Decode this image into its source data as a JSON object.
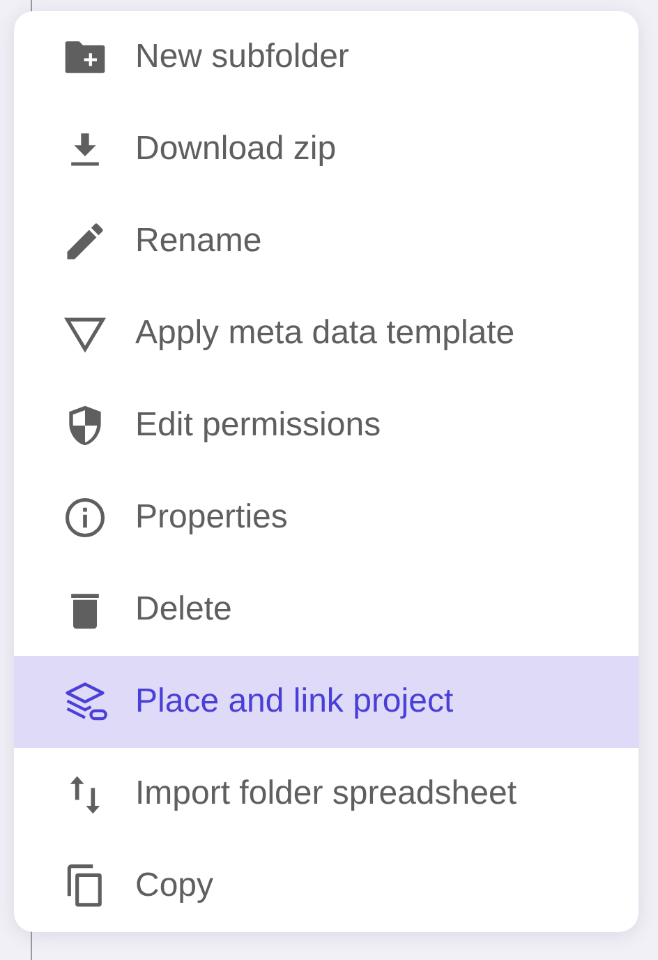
{
  "menu": {
    "items": [
      {
        "label": "New subfolder",
        "selected": false
      },
      {
        "label": "Download zip",
        "selected": false
      },
      {
        "label": "Rename",
        "selected": false
      },
      {
        "label": "Apply meta data template",
        "selected": false
      },
      {
        "label": "Edit permissions",
        "selected": false
      },
      {
        "label": "Properties",
        "selected": false
      },
      {
        "label": "Delete",
        "selected": false
      },
      {
        "label": "Place and link project",
        "selected": true
      },
      {
        "label": "Import folder spreadsheet",
        "selected": false
      },
      {
        "label": "Copy",
        "selected": false
      }
    ]
  }
}
